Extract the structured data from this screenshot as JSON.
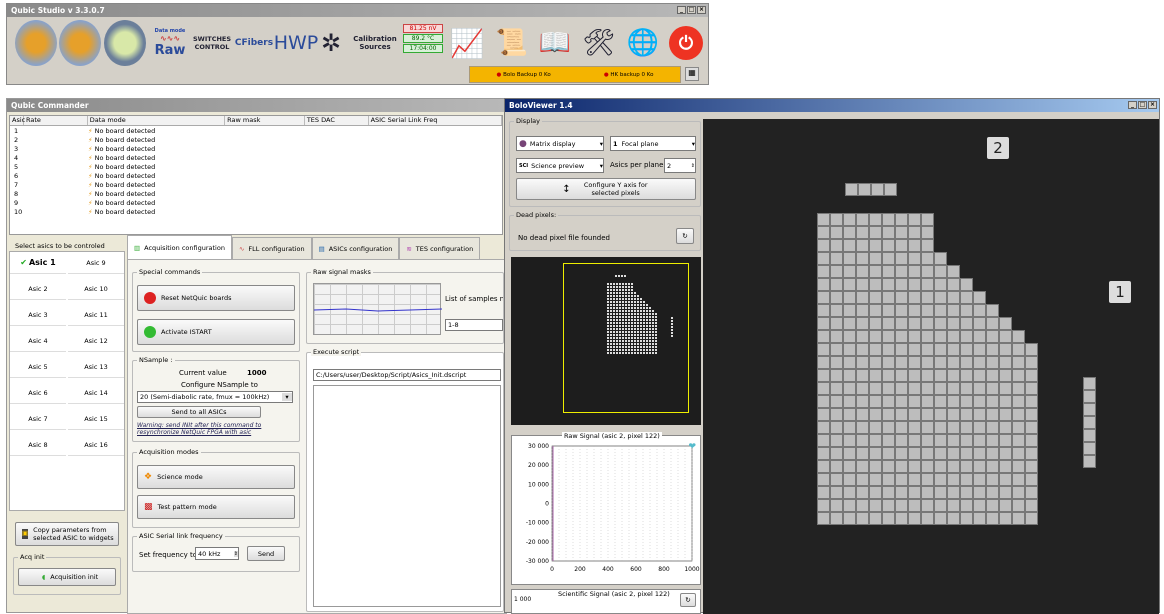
{
  "studio": {
    "title": "Qubic Studio v 3.3.0.7",
    "data_mode_label": "Data mode",
    "raw_label": "Raw",
    "switches_label": "SWITCHES CONTROL",
    "cfibers_label": "CFibers",
    "hwp_label": "HWP",
    "calibration_label": "Calibration Sources",
    "readouts": [
      "81.25 nV",
      "89.2 °C",
      "17:04:00"
    ],
    "bolo_backup_label": "Bolo Backup",
    "bolo_backup_size": "0 Ko",
    "hk_backup_label": "HK backup",
    "hk_backup_size": "0 Ko"
  },
  "commander": {
    "title": "Qubic Commander",
    "columns": [
      "Asic",
      "Rate",
      "Data mode",
      "Raw mask",
      "TES DAC",
      "ASIC Serial Link Freq"
    ],
    "rows": [
      {
        "asic": "1",
        "mode": "No board detected"
      },
      {
        "asic": "2",
        "mode": "No board detected"
      },
      {
        "asic": "3",
        "mode": "No board detected"
      },
      {
        "asic": "4",
        "mode": "No board detected"
      },
      {
        "asic": "5",
        "mode": "No board detected"
      },
      {
        "asic": "6",
        "mode": "No board detected"
      },
      {
        "asic": "7",
        "mode": "No board detected"
      },
      {
        "asic": "8",
        "mode": "No board detected"
      },
      {
        "asic": "9",
        "mode": "No board detected"
      },
      {
        "asic": "10",
        "mode": "No board detected"
      }
    ],
    "select_label": "Select asics to be controled",
    "asics_left": [
      "Asic 1",
      "Asic 2",
      "Asic 3",
      "Asic 4",
      "Asic 5",
      "Asic 6",
      "Asic 7",
      "Asic 8"
    ],
    "asics_right": [
      "Asic 9",
      "Asic 10",
      "Asic 11",
      "Asic 12",
      "Asic 13",
      "Asic 14",
      "Asic 15",
      "Asic 16"
    ],
    "copy_button": "Copy parameters from selected ASIC to widgets",
    "acq_init_group": "Acq init",
    "acq_init_button": "Acquisition init",
    "tabs": [
      "Acquisition configuration",
      "FLL configuration",
      "ASICs configuration",
      "TES configuration"
    ],
    "special_commands": "Special commands",
    "reset_button": "Reset NetQuic boards",
    "activate_button": "Activate ISTART",
    "nsample_group": "NSample :",
    "current_value_label": "Current value",
    "current_value": "1000",
    "configure_label": "Configure NSample to",
    "nsample_select": "20  (Semi-diabolic rate, fmux = 100kHz)",
    "send_all_button": "Send to all ASICs",
    "warning": "Warning: send INIt after this command to resynchronize NetQuic FPGA with asic",
    "acq_modes_group": "Acquisition modes",
    "science_button": "Science mode",
    "test_pattern_button": "Test pattern mode",
    "serial_group": "ASIC Serial link frequency",
    "set_freq_label": "Set frequency to",
    "freq_value": "40 kHz",
    "send_button": "Send",
    "raw_masks_group": "Raw signal masks",
    "samples_label": "List of samples not t",
    "samples_value": "1-8",
    "execute_group": "Execute script",
    "script_path": "C:/Users/user/Desktop/Script/Asics_Init.dscript"
  },
  "bolo": {
    "title": "BoloViewer 1.4",
    "display_group": "Display",
    "matrix_select": "Matrix display",
    "focal_select": "Focal plane",
    "science_select": "Science preview",
    "asics_per_plane_label": "Asics per plane",
    "asics_per_plane": "2",
    "configure_y_button": "Configure Y axis for selected pixels",
    "dead_group": "Dead pixels:",
    "dead_text": "No dead pixel file founded",
    "raw_chart_title": "Raw Signal (asic 2, pixel 122)",
    "sci_chart_title": "Scientific Signal (asic 2, pixel 122)",
    "chip_top": "2",
    "chip_right": "1",
    "sci_y_first": "1 000"
  },
  "chart_data": {
    "type": "line",
    "title": "Raw Signal (asic 2, pixel 122)",
    "xlim": [
      0,
      1000
    ],
    "ylim": [
      -30000,
      30000
    ],
    "xticks": [
      "0",
      "200",
      "400",
      "600",
      "800",
      "1000"
    ],
    "yticks": [
      "30 000",
      "20 000",
      "10 000",
      "0",
      "-10 000",
      "-20 000",
      "-30 000"
    ]
  }
}
